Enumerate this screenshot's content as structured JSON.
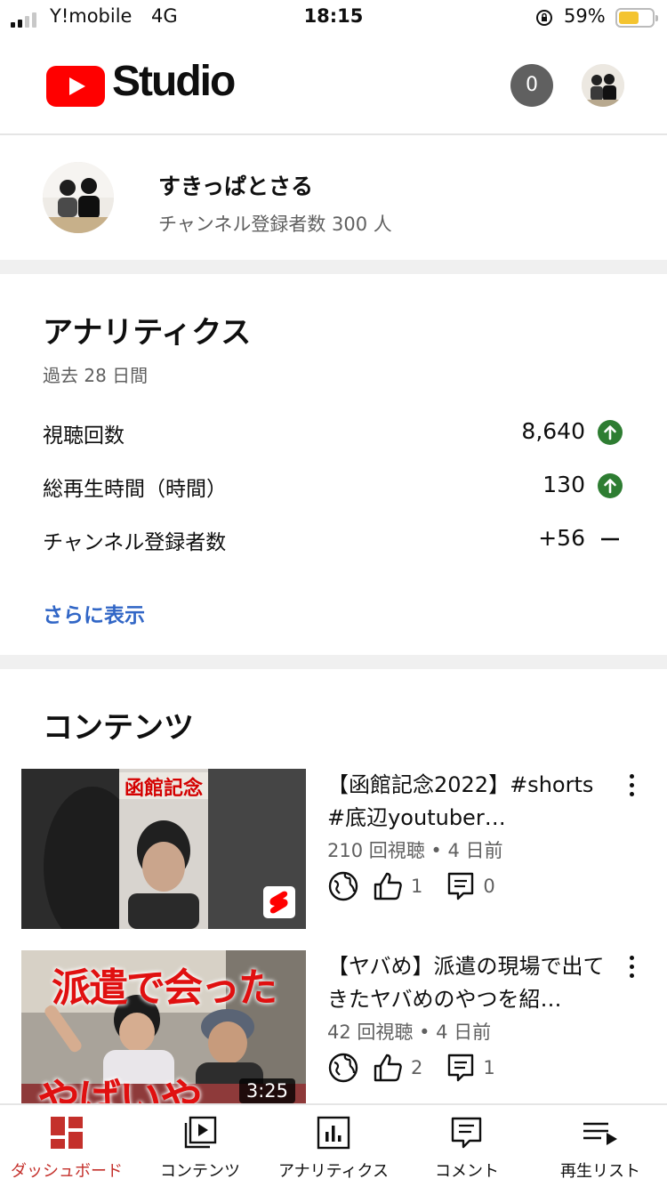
{
  "status_bar": {
    "carrier": "Y!mobile",
    "network": "4G",
    "time": "18:15",
    "battery": "59%",
    "battery_level": 0.59,
    "signal_bars": 2
  },
  "header": {
    "logo_text": "Studio",
    "notification_count": "0",
    "logo_color": "#ff0000"
  },
  "channel": {
    "name": "すきっぱとさる",
    "subscribers": "チャンネル登録者数 300 人"
  },
  "analytics": {
    "title": "アナリティクス",
    "period": "過去 28 日間",
    "metrics": [
      {
        "label": "視聴回数",
        "value": "8,640",
        "trend": "up"
      },
      {
        "label": "総再生時間（時間）",
        "value": "130",
        "trend": "up"
      },
      {
        "label": "チャンネル登録者数",
        "value": "+56",
        "trend": "flat"
      }
    ],
    "more_label": "さらに表示",
    "up_color": "#2e7d32",
    "link_color": "#3166c6"
  },
  "contents": {
    "title": "コンテンツ",
    "videos": [
      {
        "thumb_caption": "函館記念",
        "title": "【函館記念2022】#shorts #底辺youtuber…",
        "meta": "210 回視聴 • 4 日前",
        "likes": "1",
        "comments": "0",
        "is_short": true
      },
      {
        "thumb_caption": "派遣で会った",
        "thumb_caption2": "やばいや",
        "title": "【ヤバめ】派遣の現場で出てきたヤバめのやつを紹…",
        "meta": "42 回視聴 • 4 日前",
        "likes": "2",
        "comments": "1",
        "duration": "3:25"
      }
    ]
  },
  "bottom_nav": {
    "items": [
      {
        "label": "ダッシュボード",
        "icon": "dashboard-icon",
        "active": true
      },
      {
        "label": "コンテンツ",
        "icon": "content-icon"
      },
      {
        "label": "アナリティクス",
        "icon": "analytics-icon"
      },
      {
        "label": "コメント",
        "icon": "comment-icon"
      },
      {
        "label": "再生リスト",
        "icon": "playlist-icon"
      }
    ],
    "active_color": "#c4302b"
  }
}
